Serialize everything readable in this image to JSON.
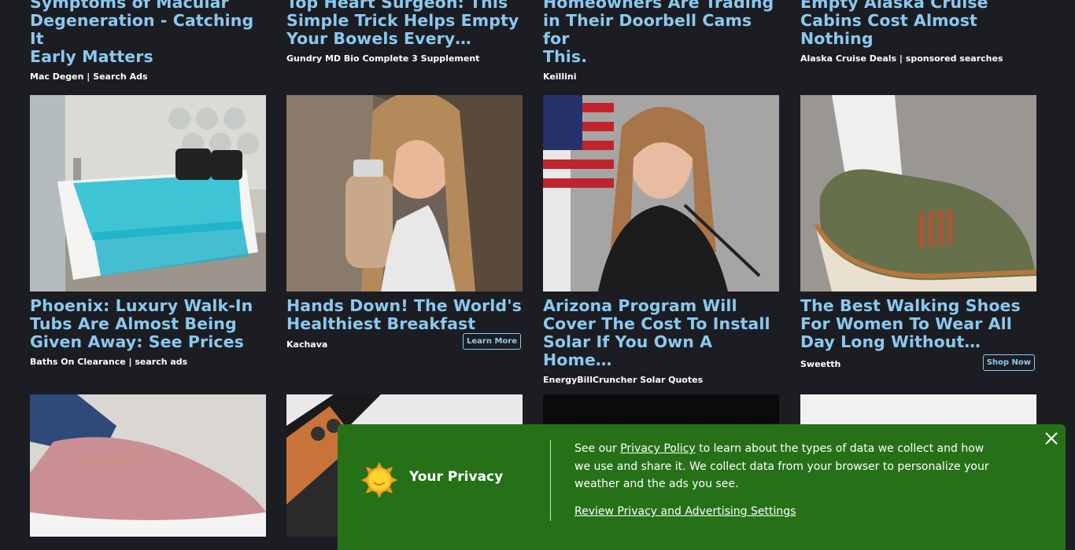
{
  "row1": [
    {
      "title_l1": "Symptoms of Macular",
      "title_l2": "Degeneration - Catching It",
      "title_l3": "Early Matters",
      "source": "Mac Degen | Search Ads"
    },
    {
      "title_l1": "Top Heart Surgeon: This",
      "title_l2": "Simple Trick Helps Empty",
      "title_l3": "Your Bowels Every…",
      "source": "Gundry MD Bio Complete 3 Supplement"
    },
    {
      "title_l1": "Homeowners Are Trading",
      "title_l2": "in Their Doorbell Cams for",
      "title_l3": "This.",
      "source": "Keillini"
    },
    {
      "title_l1": "Empty Alaska Cruise",
      "title_l2": "Cabins Cost Almost",
      "title_l3": "Nothing",
      "source": "Alaska Cruise Deals | sponsored searches"
    }
  ],
  "row2": [
    {
      "title_l1": "Phoenix: Luxury Walk-In",
      "title_l2": "Tubs Are Almost Being",
      "title_l3": "Given Away: See Prices",
      "source": "Baths On Clearance | search ads",
      "cta": ""
    },
    {
      "title_l1": "Hands Down! The World's",
      "title_l2": "Healthiest Breakfast",
      "title_l3": "",
      "source": "Kachava",
      "cta": "Learn More"
    },
    {
      "title_l1": "Arizona Program Will",
      "title_l2": "Cover The Cost To Install",
      "title_l3": "Solar If You Own A Home…",
      "source": "EnergyBillCruncher Solar Quotes",
      "cta": ""
    },
    {
      "title_l1": "The Best Walking Shoes",
      "title_l2": "For Women To Wear All",
      "title_l3": "Day Long Without…",
      "source": "Sweetth",
      "cta": "Shop Now"
    }
  ],
  "privacy": {
    "title": "Your Privacy",
    "text_before": "See our ",
    "policy_link": "Privacy Policy",
    "text_after": " to learn about the types of data we collect and how we use and share it. We collect data from your browser to personalize your weather and the ads you see.",
    "review_link": "Review Privacy and Advertising Settings"
  },
  "colors": {
    "title": "#89c9f0",
    "banner": "#267118",
    "background": "#1c1d22"
  },
  "icons": {
    "sun": "sun-icon",
    "close": "close-icon"
  }
}
